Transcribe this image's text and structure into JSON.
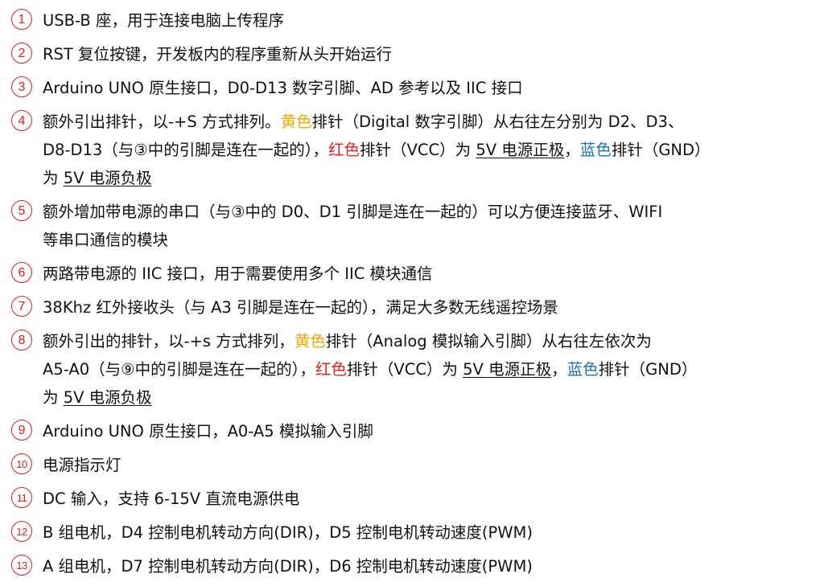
{
  "items": [
    {
      "num": "1",
      "lines": [
        [
          "USB-B 座，用于连接电脑上传程序"
        ]
      ]
    },
    {
      "num": "2",
      "lines": [
        [
          "RST 复位按键，开发板内的程序重新从头开始运行"
        ]
      ]
    },
    {
      "num": "3",
      "lines": [
        [
          "Arduino UNO 原生接口，D0-D13 数字引脚、AD 参考以及 IIC 接口"
        ]
      ]
    },
    {
      "num": "4",
      "lines": [
        [
          "额外引出排针，以-+S 方式排列。",
          "黄色",
          "排针（Digital 数字引脚）从右往左分别为 D2、D3、"
        ],
        [
          "D8-D13（与③中的引脚是连在一起的），",
          "红色",
          "排针（VCC）为 ",
          "5V 电源正极",
          "，",
          "蓝色",
          "排针（GND）"
        ],
        [
          "为 ",
          "5V 电源负极"
        ]
      ]
    },
    {
      "num": "5",
      "lines": [
        [
          "额外增加带电源的串口（与③中的 D0、D1 引脚是连在一起的）可以方便连接蓝牙、WIFI"
        ],
        [
          "等串口通信的模块"
        ]
      ]
    },
    {
      "num": "6",
      "lines": [
        [
          "两路带电源的 IIC 接口，用于需要使用多个 IIC 模块通信"
        ]
      ]
    },
    {
      "num": "7",
      "lines": [
        [
          "38Khz 红外接收头（与 A3 引脚是连在一起的），满足大多数无线遥控场景"
        ]
      ]
    },
    {
      "num": "8",
      "lines": [
        [
          "额外引出的排针，以-+s 方式排列，",
          "黄色",
          "排针（Analog 模拟输入引脚）从右往左依次为"
        ],
        [
          "A5-A0（与⑨中的引脚是连在一起的），",
          "红色",
          "排针（VCC）为 ",
          "5V 电源正极",
          "，",
          "蓝色",
          "排针（GND）"
        ],
        [
          "为 ",
          "5V 电源负极"
        ]
      ]
    },
    {
      "num": "9",
      "lines": [
        [
          "Arduino UNO 原生接口，A0-A5 模拟输入引脚"
        ]
      ]
    },
    {
      "num": "10",
      "lines": [
        [
          "电源指示灯"
        ]
      ]
    },
    {
      "num": "11",
      "lines": [
        [
          "DC 输入，支持 6-15V 直流电源供电"
        ]
      ]
    },
    {
      "num": "12",
      "lines": [
        [
          "B 组电机，D4 控制电机转动方向(DIR)，D5 控制电机转动速度(PWM)"
        ]
      ]
    },
    {
      "num": "13",
      "lines": [
        [
          "A 组电机，D7 控制电机转动方向(DIR)，D6 控制电机转动速度(PWM)"
        ]
      ]
    }
  ],
  "colors": {
    "number_circle": "#e0201e",
    "yellow_text": "#f5a800",
    "red_text": "#ee1c1c",
    "blue_text": "#1e6fbf"
  }
}
